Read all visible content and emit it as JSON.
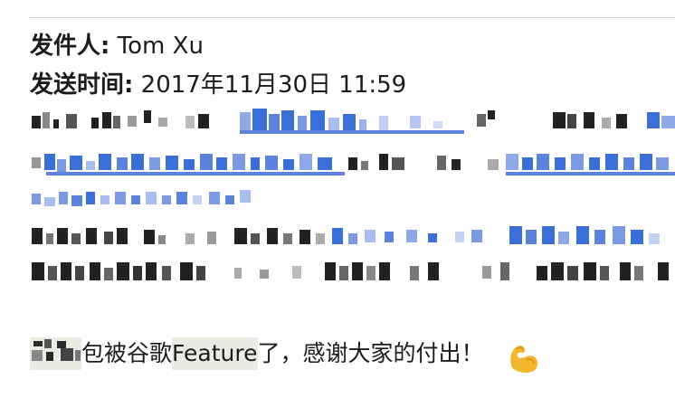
{
  "email_header": {
    "from_label": "发件人:",
    "from_value": "Tom Xu",
    "sent_label": "发送时间:",
    "sent_value": "2017年11月30日 11:59"
  },
  "body": {
    "redacted_note": "",
    "closing": {
      "before": "包被谷歌",
      "highlight": "Feature",
      "after": "了，感谢大家的付出！"
    },
    "emoji_icon": "flexed-biceps-icon"
  },
  "colors": {
    "link_blue": "#3b6fd8",
    "text": "#1c1c1e",
    "highlight_bg": "#ebebe4",
    "emoji_yellow": "#f2b72c",
    "divider": "#d8d8dc"
  }
}
